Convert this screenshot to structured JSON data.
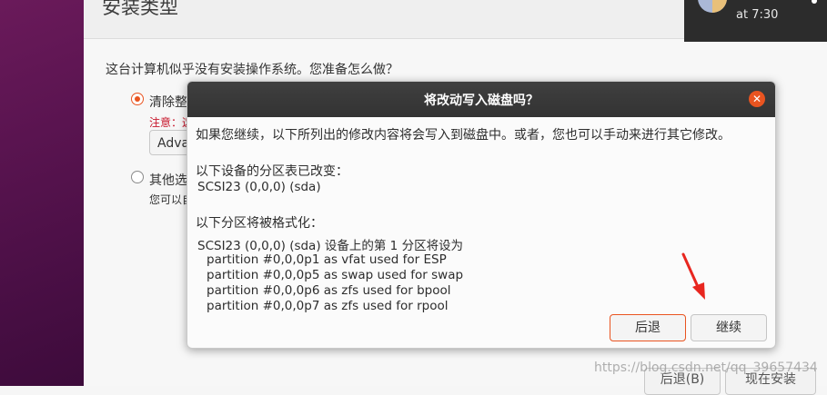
{
  "installer": {
    "title": "安装类型",
    "question": "这台计算机似乎没有安装操作系统。您准备怎么做？",
    "option1_label": "清除整",
    "option1_note": "注意：这",
    "advanced_button": "Adva",
    "option2_label": "其他选",
    "option2_note": "您可以自",
    "back_button": "后退(B)",
    "install_button": "现在安装"
  },
  "notification": {
    "time": "at 7:30"
  },
  "dialog": {
    "title": "将改动写入磁盘吗？",
    "intro": "如果您继续，以下所列出的修改内容将会写入到磁盘中。或者，您也可以手动来进行其它修改。",
    "partition_table_header": "以下设备的分区表已改变：",
    "partition_table_device": "SCSI23 (0,0,0) (sda)",
    "format_header": "以下分区将被格式化：",
    "format_device_line": "SCSI23 (0,0,0) (sda) 设备上的第 1 分区将设为",
    "partitions": [
      "partition #0,0,0p1 as vfat used for ESP",
      "partition #0,0,0p5 as swap used for swap",
      "partition #0,0,0p6 as zfs used for bpool",
      "partition #0,0,0p7 as zfs used for rpool"
    ],
    "back_button": "后退",
    "continue_button": "继续"
  },
  "watermark": "https://blog.csdn.net/qq_39657434",
  "colors": {
    "accent": "#e95420",
    "titlebar": "#3a3a3a",
    "arrow": "#e8261f"
  }
}
